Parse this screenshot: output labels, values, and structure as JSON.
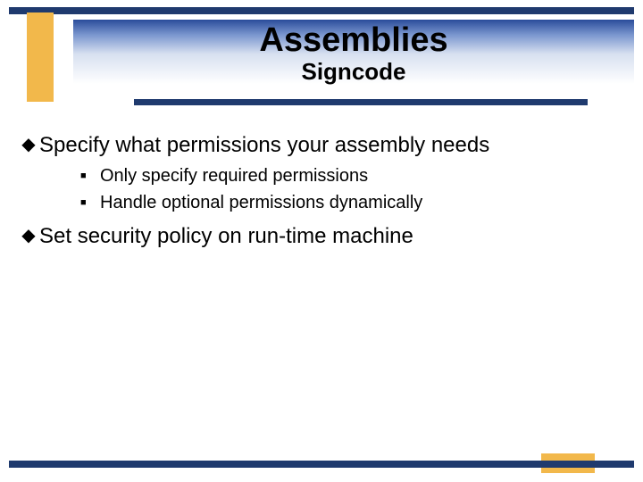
{
  "title": "Assemblies",
  "subtitle": "Signcode",
  "bullets": [
    {
      "text": "Specify what permissions your assembly needs",
      "children": [
        "Only specify required permissions",
        "Handle optional permissions dynamically"
      ]
    },
    {
      "text": "Set security policy on run-time machine",
      "children": []
    }
  ],
  "colors": {
    "navy": "#1f3a6e",
    "gold": "#f2b84b"
  }
}
